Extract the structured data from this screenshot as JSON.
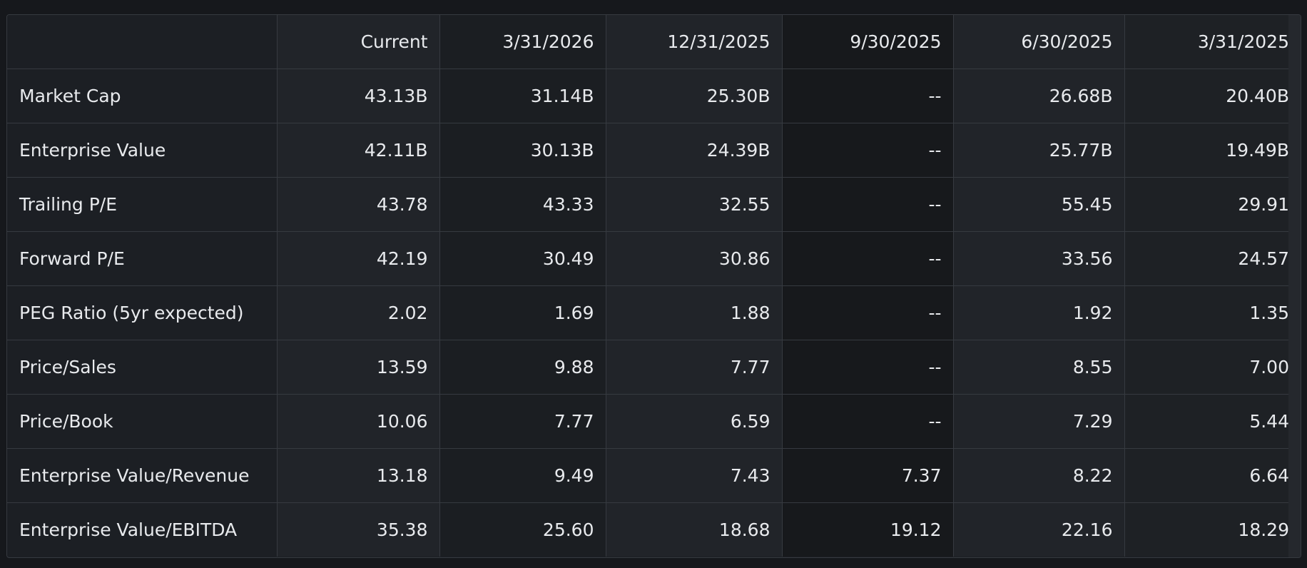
{
  "table": {
    "columns": [
      "",
      "Current",
      "3/31/2026",
      "12/31/2025",
      "9/30/2025",
      "6/30/2025",
      "3/31/2025"
    ],
    "rows": [
      {
        "label": "Market Cap",
        "values": [
          "43.13B",
          "31.14B",
          "25.30B",
          "--",
          "26.68B",
          "20.40B"
        ]
      },
      {
        "label": "Enterprise Value",
        "values": [
          "42.11B",
          "30.13B",
          "24.39B",
          "--",
          "25.77B",
          "19.49B"
        ]
      },
      {
        "label": "Trailing P/E",
        "values": [
          "43.78",
          "43.33",
          "32.55",
          "--",
          "55.45",
          "29.91"
        ]
      },
      {
        "label": "Forward P/E",
        "values": [
          "42.19",
          "30.49",
          "30.86",
          "--",
          "33.56",
          "24.57"
        ]
      },
      {
        "label": "PEG Ratio (5yr expected)",
        "values": [
          "2.02",
          "1.69",
          "1.88",
          "--",
          "1.92",
          "1.35"
        ]
      },
      {
        "label": "Price/Sales",
        "values": [
          "13.59",
          "9.88",
          "7.77",
          "--",
          "8.55",
          "7.00"
        ]
      },
      {
        "label": "Price/Book",
        "values": [
          "10.06",
          "7.77",
          "6.59",
          "--",
          "7.29",
          "5.44"
        ]
      },
      {
        "label": "Enterprise Value/Revenue",
        "values": [
          "13.18",
          "9.49",
          "7.43",
          "7.37",
          "8.22",
          "6.64"
        ]
      },
      {
        "label": "Enterprise Value/EBITDA",
        "values": [
          "35.38",
          "25.60",
          "18.68",
          "19.12",
          "22.16",
          "18.29"
        ]
      }
    ]
  }
}
